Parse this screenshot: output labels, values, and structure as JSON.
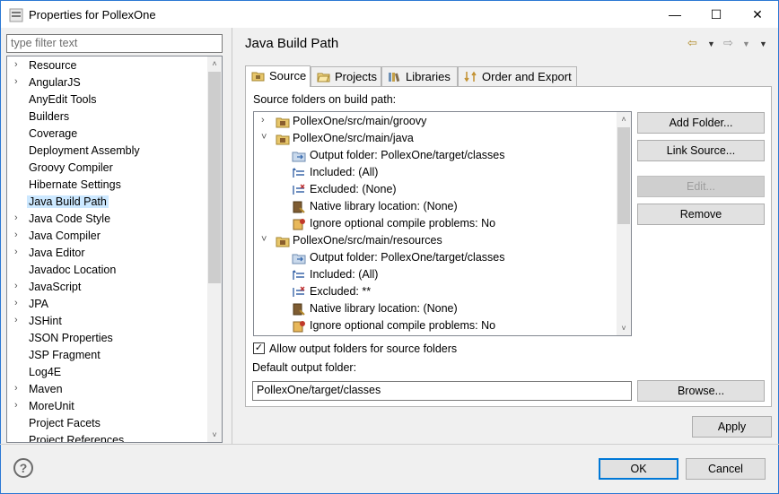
{
  "window": {
    "title": "Properties for PollexOne",
    "minimize": "—",
    "maximize": "☐",
    "close": "✕"
  },
  "filter": {
    "placeholder": "type filter text"
  },
  "tree": {
    "items": [
      {
        "label": "Resource",
        "expandable": true
      },
      {
        "label": "AngularJS",
        "expandable": true
      },
      {
        "label": "AnyEdit Tools",
        "expandable": false
      },
      {
        "label": "Builders",
        "expandable": false
      },
      {
        "label": "Coverage",
        "expandable": false
      },
      {
        "label": "Deployment Assembly",
        "expandable": false
      },
      {
        "label": "Groovy Compiler",
        "expandable": false
      },
      {
        "label": "Hibernate Settings",
        "expandable": false
      },
      {
        "label": "Java Build Path",
        "expandable": false,
        "selected": true
      },
      {
        "label": "Java Code Style",
        "expandable": true
      },
      {
        "label": "Java Compiler",
        "expandable": true
      },
      {
        "label": "Java Editor",
        "expandable": true
      },
      {
        "label": "Javadoc Location",
        "expandable": false
      },
      {
        "label": "JavaScript",
        "expandable": true
      },
      {
        "label": "JPA",
        "expandable": true
      },
      {
        "label": "JSHint",
        "expandable": true
      },
      {
        "label": "JSON Properties",
        "expandable": false
      },
      {
        "label": "JSP Fragment",
        "expandable": false
      },
      {
        "label": "Log4E",
        "expandable": false
      },
      {
        "label": "Maven",
        "expandable": true
      },
      {
        "label": "MoreUnit",
        "expandable": true
      },
      {
        "label": "Project Facets",
        "expandable": false
      },
      {
        "label": "Project References",
        "expandable": false
      }
    ]
  },
  "page": {
    "title": "Java Build Path"
  },
  "tabs": [
    {
      "label": "Source",
      "active": true
    },
    {
      "label": "Projects",
      "active": false
    },
    {
      "label": "Libraries",
      "active": false
    },
    {
      "label": "Order and Export",
      "active": false
    }
  ],
  "source": {
    "heading": "Source folders on build path:",
    "rows": [
      {
        "level": 0,
        "chevron": "›",
        "icon": "source-folder-icon",
        "text": "PollexOne/src/main/groovy"
      },
      {
        "level": 0,
        "chevron": "⌄",
        "icon": "source-folder-icon",
        "text": "PollexOne/src/main/java"
      },
      {
        "level": 1,
        "chevron": "",
        "icon": "output-folder-icon",
        "text": "Output folder: PollexOne/target/classes"
      },
      {
        "level": 1,
        "chevron": "",
        "icon": "included-icon",
        "text": "Included: (All)"
      },
      {
        "level": 1,
        "chevron": "",
        "icon": "excluded-icon",
        "text": "Excluded: (None)"
      },
      {
        "level": 1,
        "chevron": "",
        "icon": "native-library-icon",
        "text": "Native library location: (None)"
      },
      {
        "level": 1,
        "chevron": "",
        "icon": "ignore-problems-icon",
        "text": "Ignore optional compile problems: No"
      },
      {
        "level": 0,
        "chevron": "⌄",
        "icon": "source-folder-icon",
        "text": "PollexOne/src/main/resources"
      },
      {
        "level": 1,
        "chevron": "",
        "icon": "output-folder-icon",
        "text": "Output folder: PollexOne/target/classes"
      },
      {
        "level": 1,
        "chevron": "",
        "icon": "included-icon",
        "text": "Included: (All)"
      },
      {
        "level": 1,
        "chevron": "",
        "icon": "excluded-icon",
        "text": "Excluded: **"
      },
      {
        "level": 1,
        "chevron": "",
        "icon": "native-library-icon",
        "text": "Native library location: (None)"
      },
      {
        "level": 1,
        "chevron": "",
        "icon": "ignore-problems-icon",
        "text": "Ignore optional compile problems: No"
      }
    ],
    "buttons": {
      "add_folder": "Add Folder...",
      "link_source": "Link Source...",
      "edit": "Edit...",
      "remove": "Remove"
    },
    "allow_output": {
      "label": "Allow output folders for source folders",
      "checked": true
    },
    "default_output_label": "Default output folder:",
    "default_output_value": "PollexOne/target/classes",
    "browse": "Browse..."
  },
  "footer": {
    "apply": "Apply",
    "ok": "OK",
    "cancel": "Cancel",
    "help": "?"
  },
  "colors": {
    "accent": "#0078d7",
    "window_border": "#2b78d4",
    "selection": "#cce8ff",
    "nav_arrow": "#b08a28"
  }
}
